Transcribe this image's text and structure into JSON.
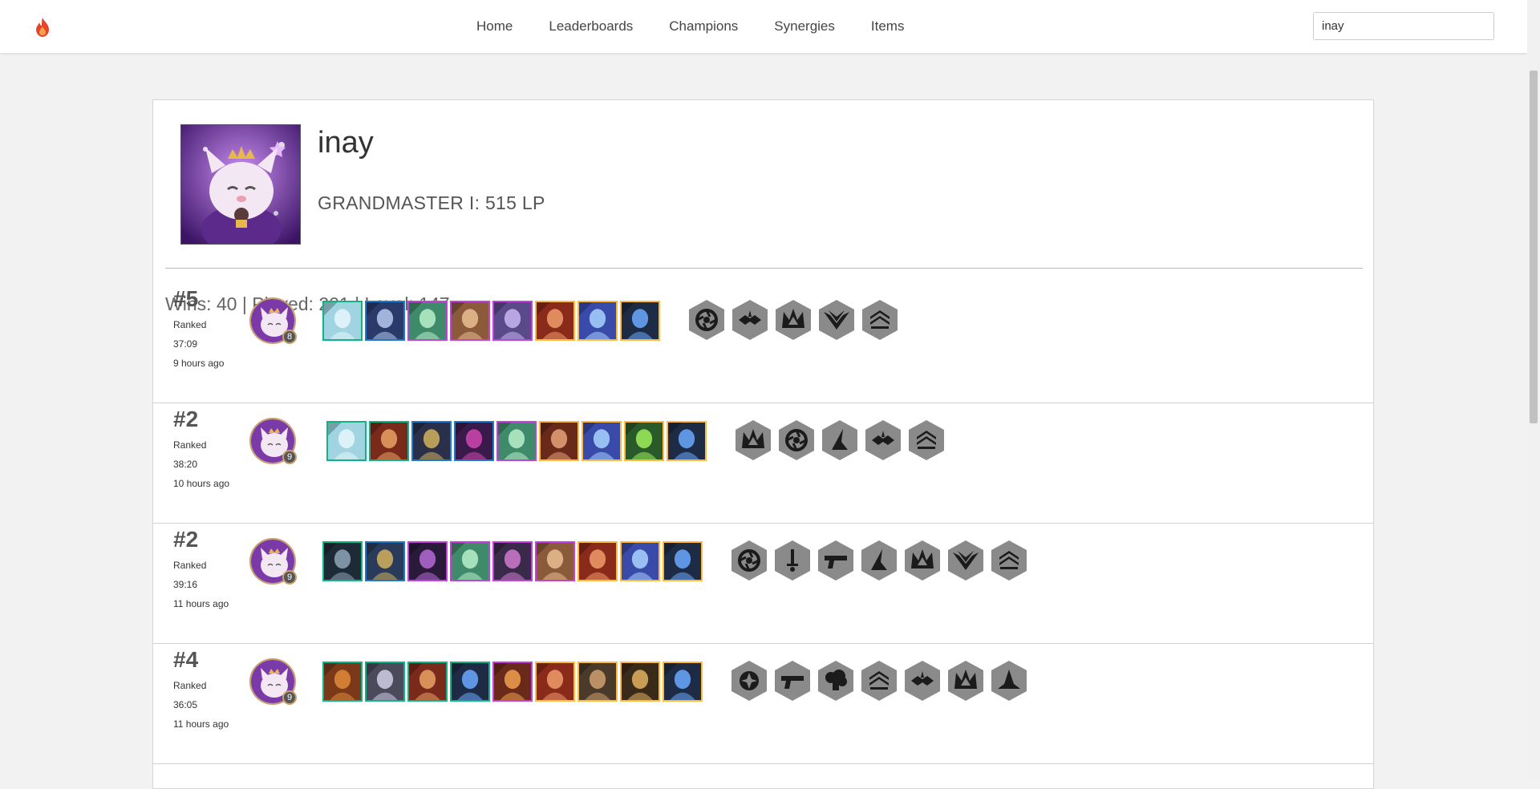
{
  "nav": {
    "logo_icon": "flame-icon",
    "links": [
      "Home",
      "Leaderboards",
      "Champions",
      "Synergies",
      "Items"
    ],
    "search_value": "inay"
  },
  "profile": {
    "name": "inay",
    "rank": "GRANDMASTER I: 515 LP",
    "stats": "Wins: 40 | Played: 201 | Level: 147",
    "avatar_icon": "little-legend-avatar"
  },
  "colors": {
    "tier1": "#9b9b9b",
    "tier2": "#11b288",
    "tier3": "#207ac7",
    "tier4": "#c440da",
    "tier5": "#ffb93b",
    "trait_bg": "#8a8a8a"
  },
  "matches": [
    {
      "place": "#5",
      "mode": "Ranked",
      "duration": "37:09",
      "ago": "9 hours ago",
      "level": "8",
      "champions": [
        {
          "tier": 2,
          "bg": "#9fd4e0",
          "fg": "#e8f6fb"
        },
        {
          "tier": 3,
          "bg": "#2a3a6a",
          "fg": "#b7c9ef"
        },
        {
          "tier": 4,
          "bg": "#3f8a6b",
          "fg": "#b9f0c9"
        },
        {
          "tier": 4,
          "bg": "#8a5a3a",
          "fg": "#e9bf93"
        },
        {
          "tier": 4,
          "bg": "#5a4a8a",
          "fg": "#c8b6f1"
        },
        {
          "tier": 5,
          "bg": "#8a2a1a",
          "fg": "#ef9c6a"
        },
        {
          "tier": 5,
          "bg": "#3a4aa8",
          "fg": "#a8d3ff"
        },
        {
          "tier": 5,
          "bg": "#1e2b44",
          "fg": "#6aa9ff"
        }
      ],
      "traits": [
        "aperture-trait-icon",
        "rebel-trait-icon",
        "crown-trait-icon",
        "wings-trait-icon",
        "stack-trait-icon"
      ]
    },
    {
      "place": "#2",
      "mode": "Ranked",
      "duration": "38:20",
      "ago": "10 hours ago",
      "level": "9",
      "champions": [
        {
          "tier": 2,
          "bg": "#9fd4e0",
          "fg": "#e8f6fb"
        },
        {
          "tier": 2,
          "bg": "#7a2a1a",
          "fg": "#e7a264"
        },
        {
          "tier": 3,
          "bg": "#2a2f4a",
          "fg": "#d2b25c"
        },
        {
          "tier": 3,
          "bg": "#3a1a4a",
          "fg": "#d048b0"
        },
        {
          "tier": 4,
          "bg": "#3f8a6b",
          "fg": "#b9f0c9"
        },
        {
          "tier": 5,
          "bg": "#6a2a1a",
          "fg": "#e5a27a"
        },
        {
          "tier": 5,
          "bg": "#3a4aa8",
          "fg": "#a8d3ff"
        },
        {
          "tier": 5,
          "bg": "#2a5a2a",
          "fg": "#9ff05a"
        },
        {
          "tier": 5,
          "bg": "#1e2b44",
          "fg": "#6aa9ff"
        }
      ],
      "traits": [
        "crown-trait-icon",
        "aperture-trait-icon",
        "blade-trait-icon",
        "rebel-trait-icon",
        "stack-trait-icon"
      ]
    },
    {
      "place": "#2",
      "mode": "Ranked",
      "duration": "39:16",
      "ago": "11 hours ago",
      "level": "9",
      "champions": [
        {
          "tier": 2,
          "bg": "#1e2a35",
          "fg": "#8fa4b8"
        },
        {
          "tier": 3,
          "bg": "#2a3a5a",
          "fg": "#d2b25c"
        },
        {
          "tier": 4,
          "bg": "#2a1a3a",
          "fg": "#b46ad6"
        },
        {
          "tier": 4,
          "bg": "#3f8a6b",
          "fg": "#b9f0c9"
        },
        {
          "tier": 4,
          "bg": "#3a2a4a",
          "fg": "#d07ad0"
        },
        {
          "tier": 4,
          "bg": "#8a5a3a",
          "fg": "#e9bf93"
        },
        {
          "tier": 5,
          "bg": "#8a2a1a",
          "fg": "#ef9c6a"
        },
        {
          "tier": 5,
          "bg": "#3a4aa8",
          "fg": "#a8d3ff"
        },
        {
          "tier": 5,
          "bg": "#1e2b44",
          "fg": "#6aa9ff"
        }
      ],
      "traits": [
        "aperture-trait-icon",
        "sword-trait-icon",
        "gun-trait-icon",
        "blade-trait-icon",
        "crown-trait-icon",
        "wings-trait-icon",
        "stack-trait-icon"
      ]
    },
    {
      "place": "#4",
      "mode": "Ranked",
      "duration": "36:05",
      "ago": "11 hours ago",
      "level": "9",
      "champions": [
        {
          "tier": 2,
          "bg": "#7a3a1a",
          "fg": "#e08a3a"
        },
        {
          "tier": 2,
          "bg": "#4a4a5a",
          "fg": "#cfcfe8"
        },
        {
          "tier": 2,
          "bg": "#7a2a1a",
          "fg": "#e7a264"
        },
        {
          "tier": 2,
          "bg": "#1e2b44",
          "fg": "#6aa9ff"
        },
        {
          "tier": 4,
          "bg": "#6a2a1a",
          "fg": "#f0a050"
        },
        {
          "tier": 5,
          "bg": "#8a2a1a",
          "fg": "#ef9c6a"
        },
        {
          "tier": 5,
          "bg": "#4a3a2a",
          "fg": "#cfa070"
        },
        {
          "tier": 5,
          "bg": "#3a2a1a",
          "fg": "#e0b060"
        },
        {
          "tier": 5,
          "bg": "#1e2b44",
          "fg": "#6aa9ff"
        }
      ],
      "traits": [
        "star-trait-icon",
        "gun-trait-icon",
        "cloud-trait-icon",
        "stack-trait-icon",
        "rebel-trait-icon",
        "crown-trait-icon",
        "ship-trait-icon"
      ]
    }
  ]
}
